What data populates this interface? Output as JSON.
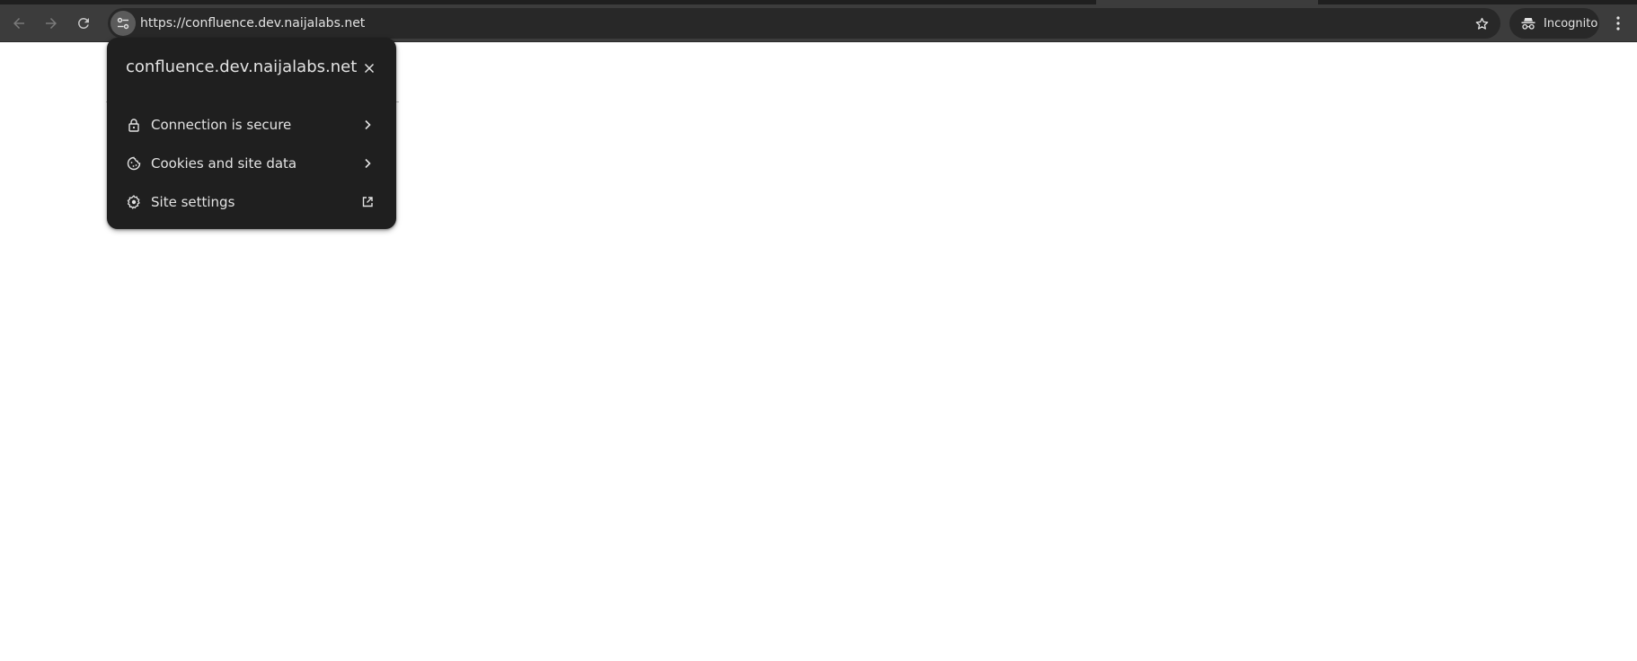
{
  "browser": {
    "url": "https://confluence.dev.naijalabs.net",
    "incognito_label": "Incognito",
    "icons": {
      "back": "arrow-left-icon",
      "forward": "arrow-right-icon",
      "reload": "reload-icon",
      "site_info": "tune-sliders-icon",
      "bookmark": "star-outline-icon",
      "incognito": "incognito-hat-glasses-icon",
      "menu": "kebab-menu-icon"
    }
  },
  "site_info_popup": {
    "title": "confluence.dev.naijalabs.net",
    "close_icon": "close-x-icon",
    "items": [
      {
        "label": "Connection is secure",
        "icon": "lock-icon",
        "trailing": "chevron-right-icon"
      },
      {
        "label": "Cookies and site data",
        "icon": "cookie-icon",
        "trailing": "chevron-right-icon"
      },
      {
        "label": "Site settings",
        "icon": "gear-icon",
        "trailing": "open-in-new-icon"
      }
    ]
  },
  "colors": {
    "toolbar": "#3c3c3c",
    "omnibox": "#282828",
    "popup_bg": "#1f1f1f",
    "text": "#e3e3e3",
    "page_bg": "#ffffff"
  }
}
